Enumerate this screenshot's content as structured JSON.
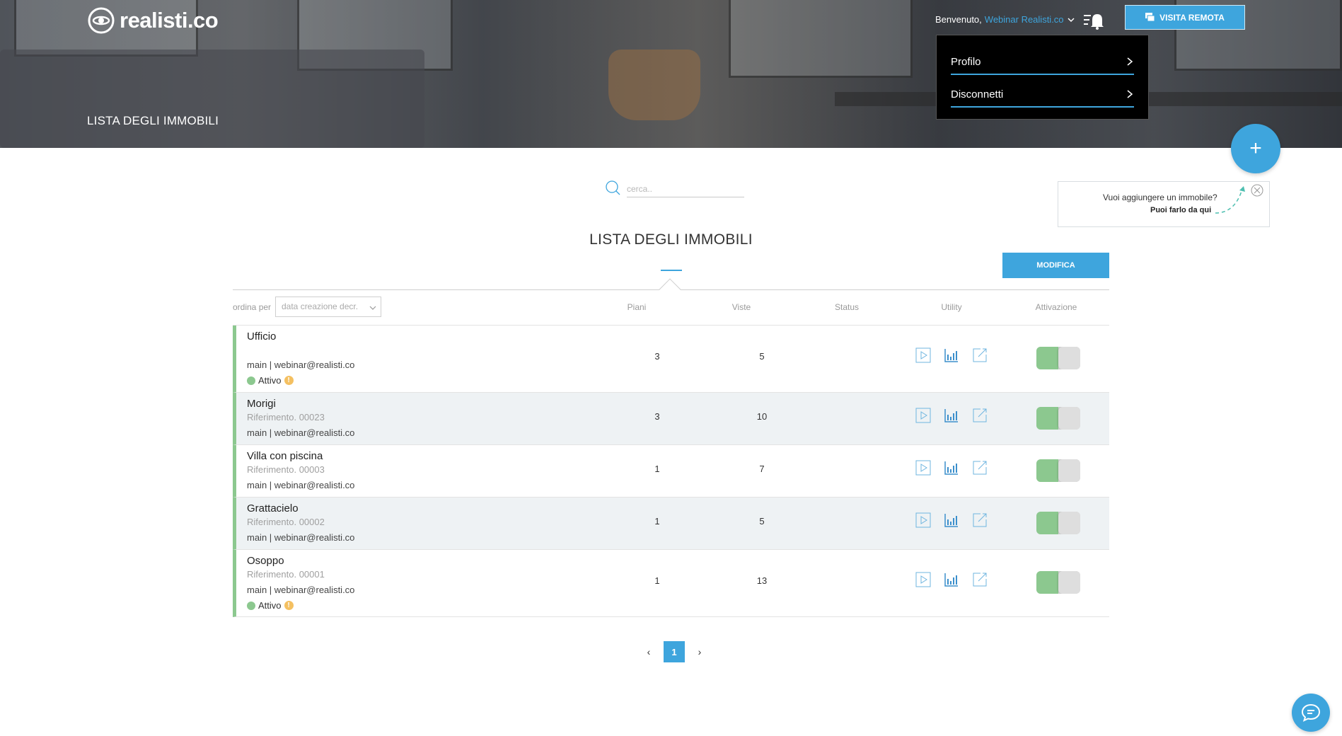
{
  "brand": {
    "logo_text": "realisti.co"
  },
  "header": {
    "page_title": "LISTA DEGLI IMMOBILI",
    "welcome_label": "Benvenuto,",
    "user_name": "Webinar Realisti.co",
    "remote_visit_label": "VISITA REMOTA"
  },
  "user_menu": {
    "items": [
      {
        "label": "Profilo"
      },
      {
        "label": "Disconnetti"
      }
    ]
  },
  "fab": {
    "label": "+"
  },
  "tip": {
    "line1": "Vuoi aggiungere un immobile?",
    "line2": "Puoi farlo da qui"
  },
  "search": {
    "placeholder": "cerca.."
  },
  "main": {
    "title": "LISTA DEGLI IMMOBILI",
    "edit_button": "MODIFICA"
  },
  "table": {
    "sort_label": "ordina per",
    "sort_value": "data creazione decr.",
    "columns": [
      "Piani",
      "Viste",
      "Status",
      "Utility",
      "Attivazione"
    ],
    "rows": [
      {
        "name": "Ufficio",
        "reference": "",
        "owner": "main | webinar@realisti.co",
        "status": "Attivo",
        "floors": "3",
        "views": "5",
        "active": true
      },
      {
        "name": "Morigi",
        "reference": "Riferimento. 00023",
        "owner": "main | webinar@realisti.co",
        "status": "",
        "floors": "3",
        "views": "10",
        "active": true
      },
      {
        "name": "Villa con piscina",
        "reference": "Riferimento. 00003",
        "owner": "main | webinar@realisti.co",
        "status": "",
        "floors": "1",
        "views": "7",
        "active": true
      },
      {
        "name": "Grattacielo",
        "reference": "Riferimento. 00002",
        "owner": "main | webinar@realisti.co",
        "status": "",
        "floors": "1",
        "views": "5",
        "active": true
      },
      {
        "name": "Osoppo",
        "reference": "Riferimento. 00001",
        "owner": "main | webinar@realisti.co",
        "status": "Attivo",
        "floors": "1",
        "views": "13",
        "active": true
      }
    ]
  },
  "pagination": {
    "prev": "‹",
    "current": "1",
    "next": "›"
  },
  "colors": {
    "accent": "#3ea5dd",
    "active_green": "#8cc88f",
    "warning": "#f4c061"
  },
  "icons": {
    "play": "play-icon",
    "stats": "bar-chart-icon",
    "edit": "edit-external-icon",
    "search": "search-icon",
    "bell": "notification-bell-icon",
    "chat": "chat-icon"
  }
}
